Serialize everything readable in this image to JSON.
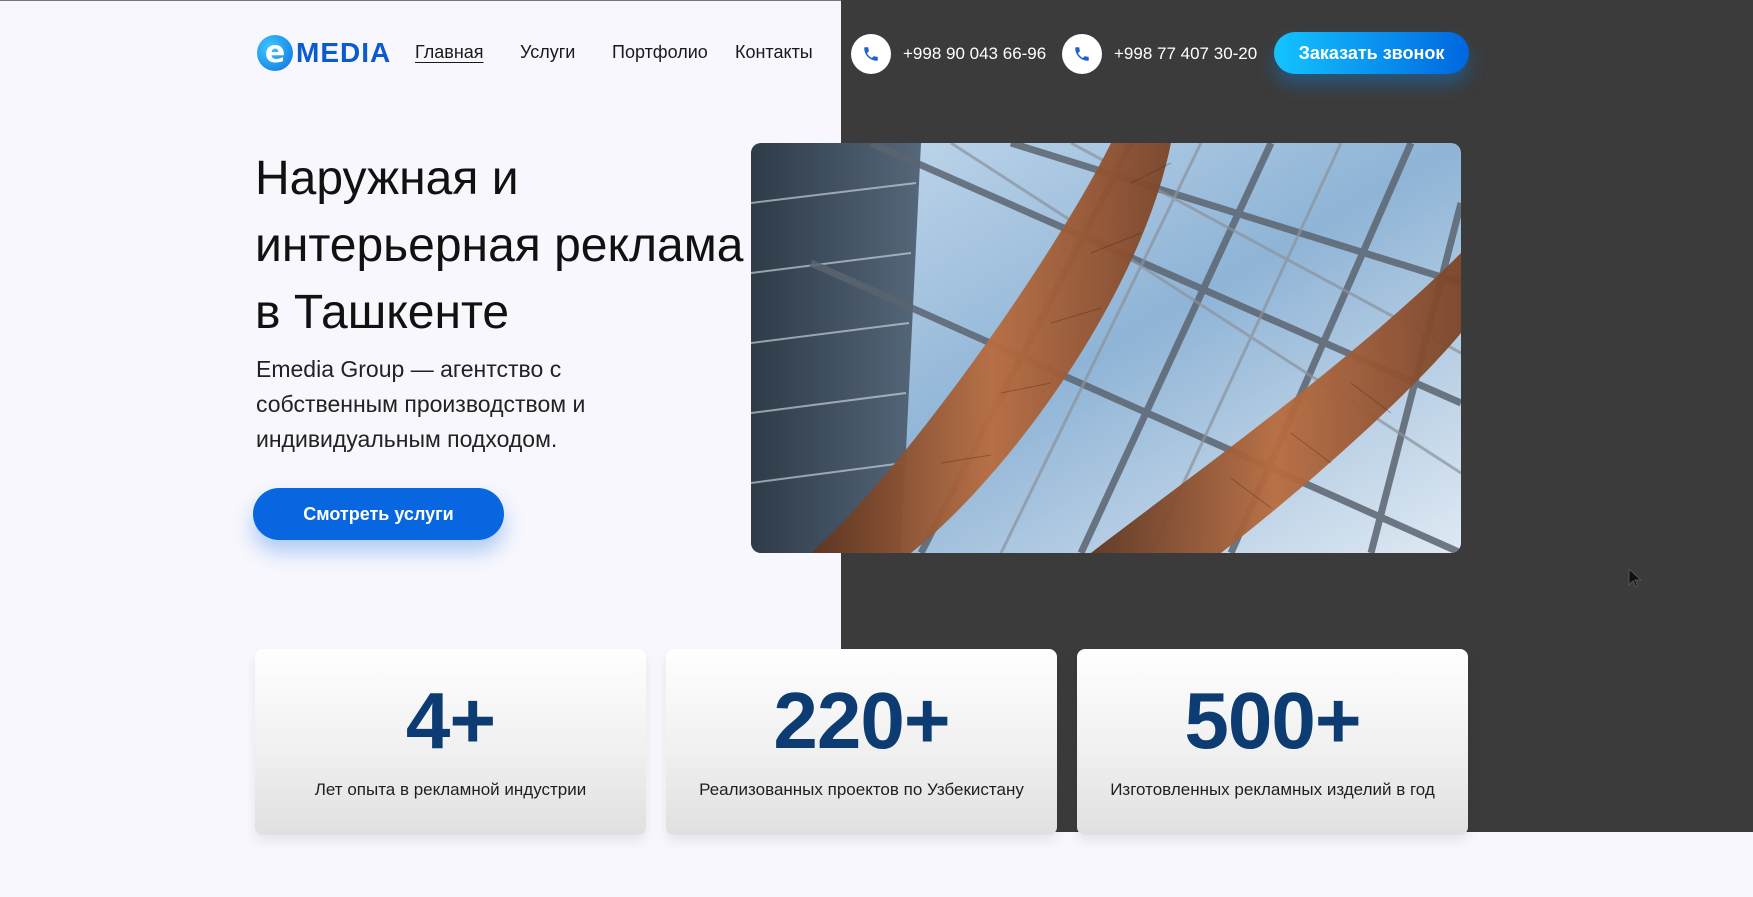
{
  "brand": {
    "logo_letter": "e",
    "name": "MEDIA"
  },
  "nav": [
    {
      "label": "Главная",
      "active": true
    },
    {
      "label": "Услуги"
    },
    {
      "label": "Портфолио"
    },
    {
      "label": "Контакты"
    }
  ],
  "phones": [
    "+998 90 043 66-96",
    "+998 77 407 30-20"
  ],
  "cta_label": "Заказать звонок",
  "hero": {
    "title": "Наружная и интерьерная реклама в Ташкенте",
    "subtitle": "Emedia Group — агентство с собственным производством и индивидуальным подходом.",
    "button": "Смотреть услуги"
  },
  "stats": [
    {
      "value": "4+",
      "label": "Лет опыта в рекламной индустрии"
    },
    {
      "value": "220+",
      "label": "Реализованных проектов по Узбекистану"
    },
    {
      "value": "500+",
      "label": "Изготовленных рекламных изделий в год"
    }
  ],
  "colors": {
    "accent": "#0866e0",
    "stat_number": "#0c3c72",
    "dark_panel": "#3b3b3b",
    "background": "#f7f7fd"
  },
  "icons": {
    "phone": "phone-icon",
    "cursor": "mouse-pointer-icon"
  }
}
